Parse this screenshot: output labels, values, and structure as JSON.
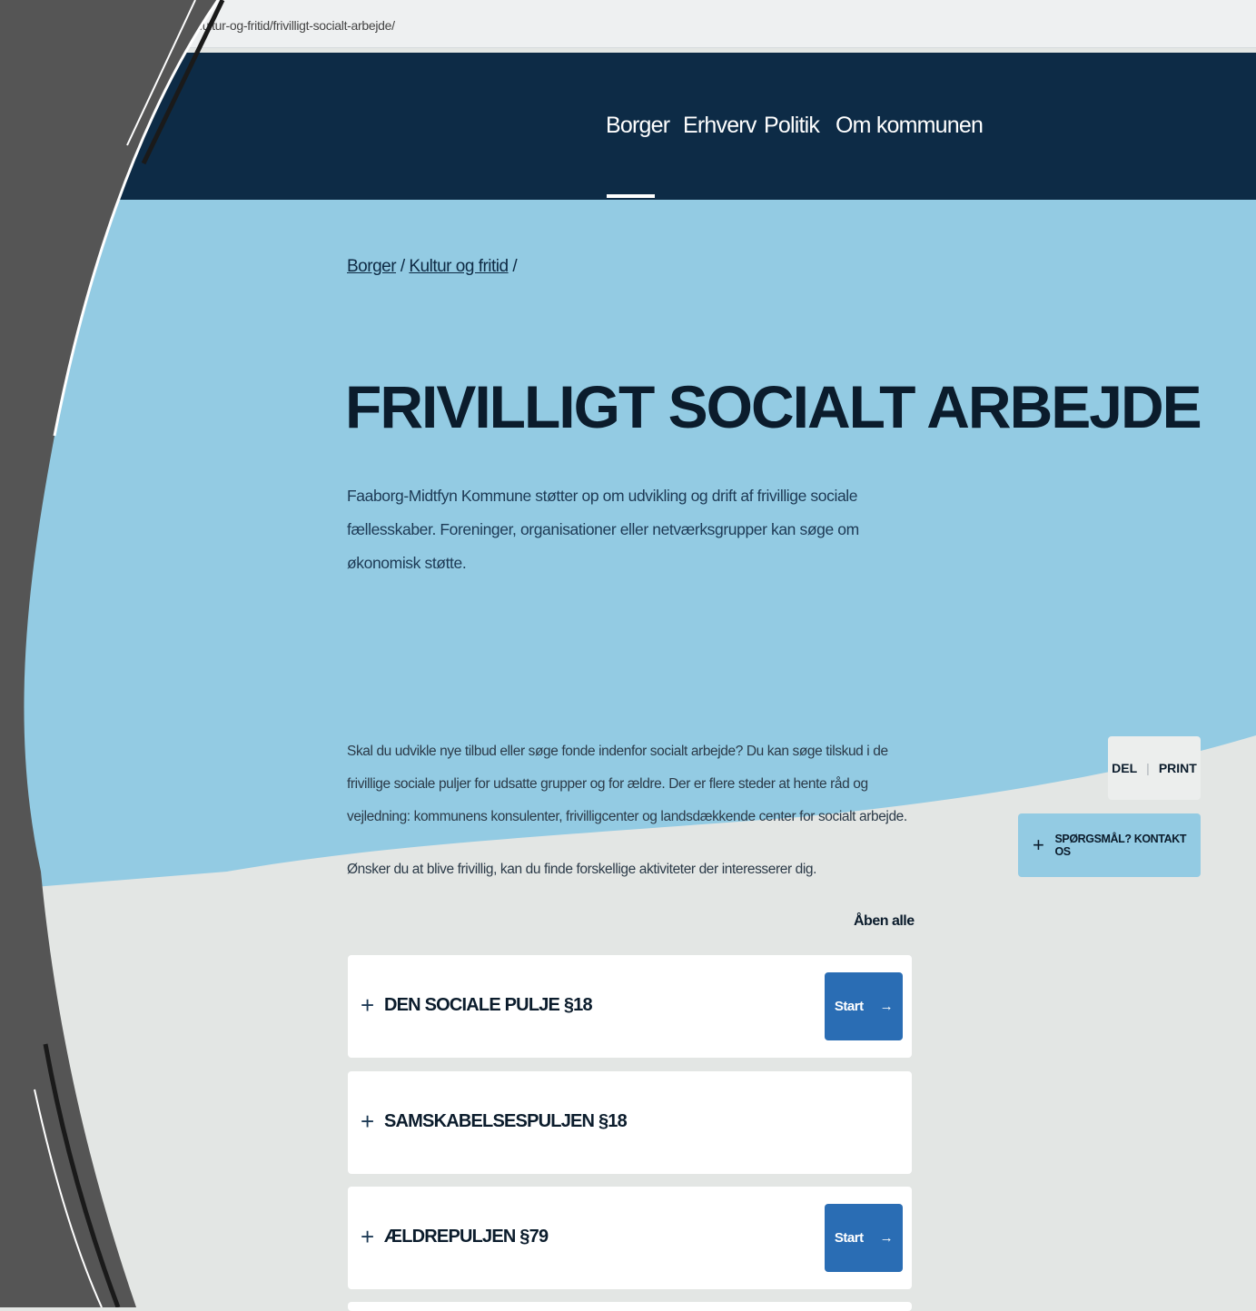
{
  "browser": {
    "url": "...ultur-og-fritid/frivilligt-socialt-arbejde/"
  },
  "nav": {
    "items": [
      "Borger",
      "Erhverv",
      "Politik",
      "Om kommunen"
    ],
    "active": "Borger"
  },
  "breadcrumb": {
    "items": [
      "Borger",
      "Kultur og fritid"
    ],
    "separator": "/"
  },
  "page": {
    "title": "FRIVILLIGT SOCIALT ARBEJDE",
    "intro": "Faaborg-Midtfyn Kommune støtter op om udvikling og drift af frivillige sociale fællesskaber. Foreninger, organisationer eller netværksgrupper kan søge om økonomisk støtte.",
    "body1": "Skal du udvikle nye tilbud eller søge fonde indenfor socialt arbejde? Du kan søge tilskud i de frivillige sociale puljer for udsatte grupper og for ældre. Der er flere steder at hente råd og vejledning: kommunens konsulenter, frivilligcenter og landsdækkende center for socialt arbejde.",
    "body2": "Ønsker du at blive frivillig, kan du finde forskellige aktiviteter der interesserer dig."
  },
  "accordion": {
    "open_all": "Åben alle",
    "items": [
      {
        "title": "DEN SOCIALE PULJE §18",
        "button": "Start"
      },
      {
        "title": "SAMSKABELSESPULJEN §18"
      },
      {
        "title": "ÆLDREPULJEN §79",
        "button": "Start"
      }
    ]
  },
  "sidebar": {
    "del": "DEL",
    "print": "PRINT",
    "contact": "SPØRGSMÅL? KONTAKT OS"
  },
  "colors": {
    "nav_bg": "#0d2b46",
    "hero_blue": "#93cbe3",
    "page_bg": "#e3e6e4",
    "button_blue": "#2a6db4",
    "frame_gray": "#555555"
  }
}
